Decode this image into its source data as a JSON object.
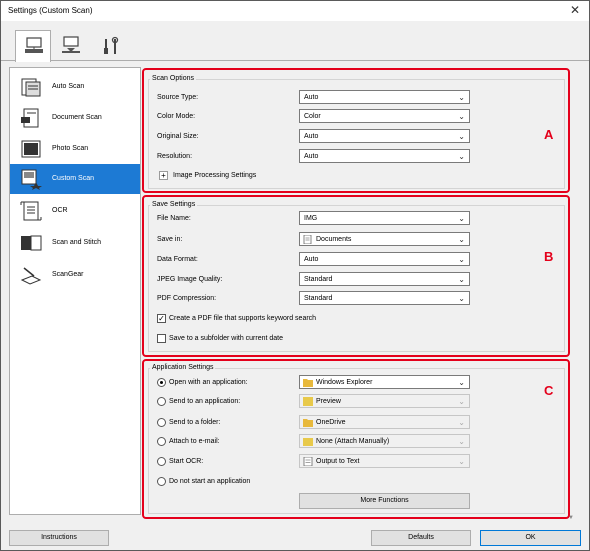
{
  "window": {
    "title": "Settings (Custom Scan)",
    "close_glyph": "✕"
  },
  "tabs": [
    {
      "icon": "scan-from-computer-icon",
      "active": true
    },
    {
      "icon": "scan-from-panel-icon",
      "active": false
    },
    {
      "icon": "general-settings-icon",
      "active": false
    }
  ],
  "sidebar": {
    "items": [
      {
        "label": "Auto Scan",
        "icon": "auto-scan-icon"
      },
      {
        "label": "Document Scan",
        "icon": "document-scan-icon"
      },
      {
        "label": "Photo Scan",
        "icon": "photo-scan-icon"
      },
      {
        "label": "Custom Scan",
        "icon": "custom-scan-icon",
        "selected": true
      },
      {
        "label": "OCR",
        "icon": "ocr-icon"
      },
      {
        "label": "Scan and Stitch",
        "icon": "scan-and-stitch-icon"
      },
      {
        "label": "ScanGear",
        "icon": "scangear-icon"
      }
    ]
  },
  "scan_options": {
    "title": "Scan Options",
    "marker": "A",
    "source_type": {
      "label": "Source Type:",
      "value": "Auto"
    },
    "color_mode": {
      "label": "Color Mode:",
      "value": "Color"
    },
    "original_size": {
      "label": "Original Size:",
      "value": "Auto"
    },
    "resolution": {
      "label": "Resolution:",
      "value": "Auto"
    },
    "image_processing": {
      "expander": "+",
      "label": "Image Processing Settings"
    }
  },
  "save_settings": {
    "title": "Save Settings",
    "marker": "B",
    "file_name": {
      "label": "File Name:",
      "value": "IMG"
    },
    "save_in": {
      "label": "Save in:",
      "value": "Documents"
    },
    "data_format": {
      "label": "Data Format:",
      "value": "Auto"
    },
    "jpeg_quality": {
      "label": "JPEG Image Quality:",
      "value": "Standard"
    },
    "pdf_compression": {
      "label": "PDF Compression:",
      "value": "Standard"
    },
    "keyword_pdf": {
      "label": "Create a PDF file that supports keyword search",
      "checked": true,
      "glyph": "✓"
    },
    "subfolder": {
      "label": "Save to a subfolder with current date",
      "checked": false
    }
  },
  "application_settings": {
    "title": "Application Settings",
    "marker": "C",
    "open_app": {
      "label": "Open with an application:",
      "value": "Windows Explorer",
      "selected": true
    },
    "send_app": {
      "label": "Send to an application:",
      "value": "Preview"
    },
    "send_folder": {
      "label": "Send to a folder:",
      "value": "OneDrive"
    },
    "attach_email": {
      "label": "Attach to e-mail:",
      "value": "None (Attach Manually)"
    },
    "start_ocr": {
      "label": "Start OCR:",
      "value": "Output to Text"
    },
    "no_app": {
      "label": "Do not start an application"
    },
    "more_functions": "More Functions"
  },
  "footer": {
    "instructions": "Instructions",
    "defaults": "Defaults",
    "ok": "OK"
  },
  "colors": {
    "accent": "#1d7ad4",
    "marker_red": "#e4001b"
  }
}
